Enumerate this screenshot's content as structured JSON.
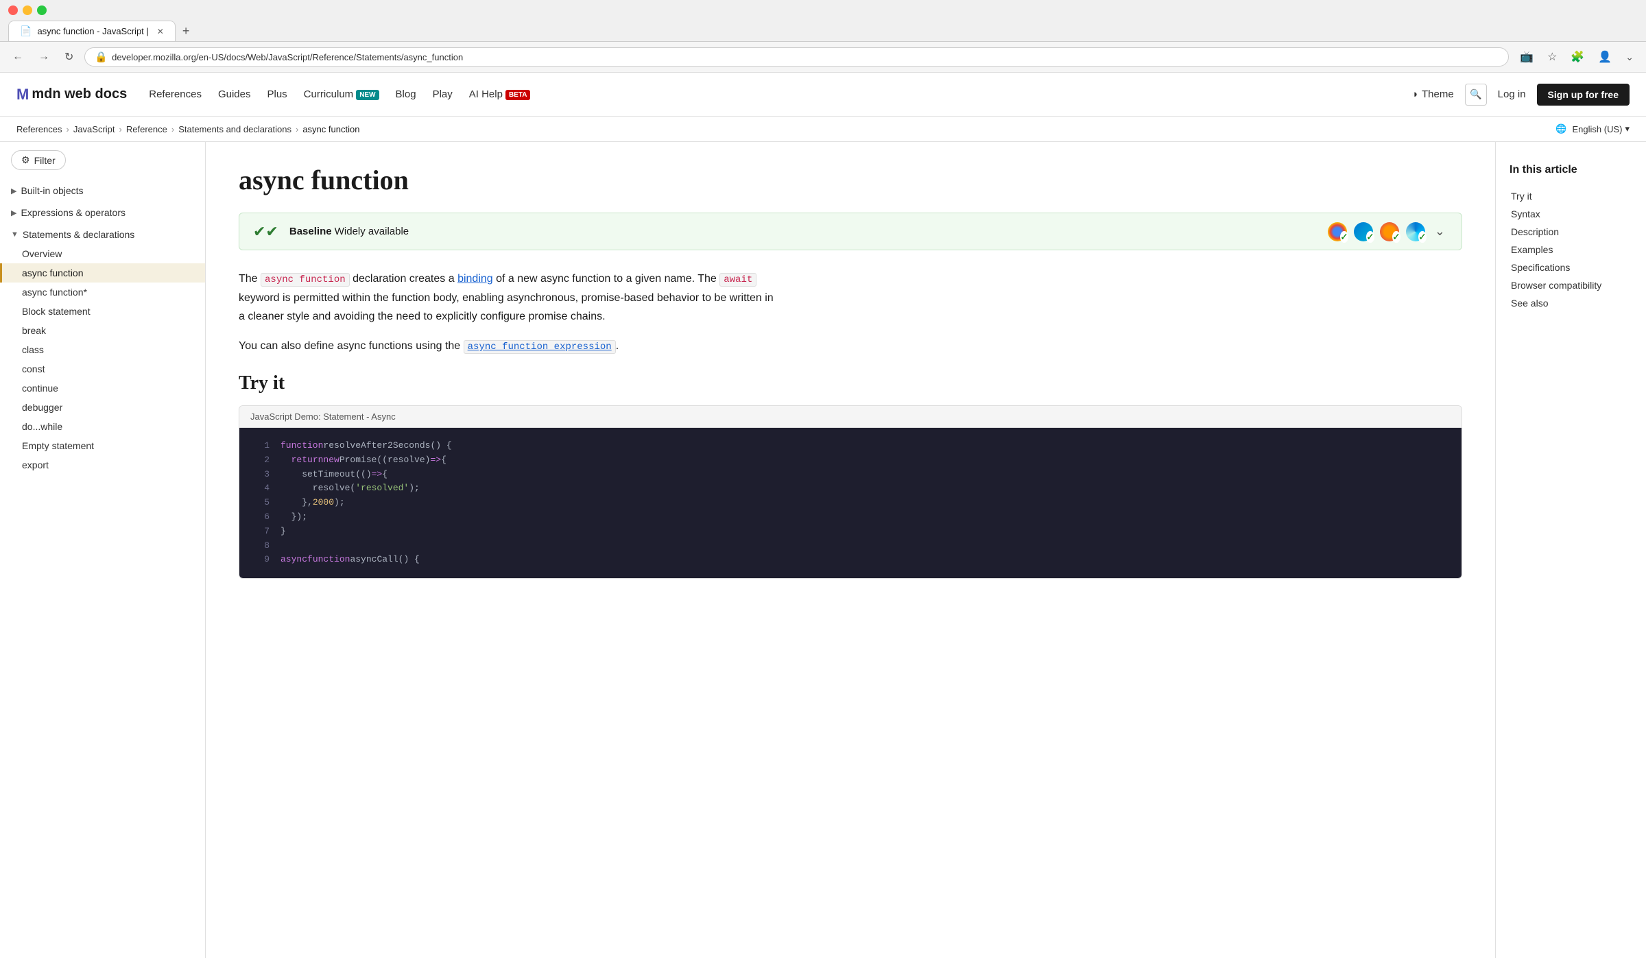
{
  "browser": {
    "tab_title": "async function - JavaScript |",
    "url": "developer.mozilla.org/en-US/docs/Web/JavaScript/Reference/Statements/async_function",
    "new_tab_label": "+"
  },
  "header": {
    "logo_m": "M",
    "logo_text": "mdn web docs",
    "nav_items": [
      {
        "label": "References",
        "badge": null
      },
      {
        "label": "Guides",
        "badge": null
      },
      {
        "label": "Plus",
        "badge": null
      },
      {
        "label": "Curriculum",
        "badge": "NEW"
      },
      {
        "label": "Blog",
        "badge": null
      },
      {
        "label": "Play",
        "badge": null
      },
      {
        "label": "AI Help",
        "badge": "BETA"
      }
    ],
    "theme_label": "Theme",
    "login_label": "Log in",
    "signup_label": "Sign up for free"
  },
  "breadcrumb": {
    "items": [
      {
        "label": "References"
      },
      {
        "label": "JavaScript"
      },
      {
        "label": "Reference"
      },
      {
        "label": "Statements and declarations"
      },
      {
        "label": "async function"
      }
    ],
    "lang": "English (US)"
  },
  "sidebar": {
    "filter_label": "Filter",
    "sections": [
      {
        "label": "Built-in objects",
        "expanded": false,
        "items": []
      },
      {
        "label": "Expressions & operators",
        "expanded": false,
        "items": []
      },
      {
        "label": "Statements & declarations",
        "expanded": true,
        "items": [
          {
            "label": "Overview",
            "active": false
          },
          {
            "label": "async function",
            "active": true
          },
          {
            "label": "async function*",
            "active": false
          },
          {
            "label": "Block statement",
            "active": false
          },
          {
            "label": "break",
            "active": false
          },
          {
            "label": "class",
            "active": false
          },
          {
            "label": "const",
            "active": false
          },
          {
            "label": "continue",
            "active": false
          },
          {
            "label": "debugger",
            "active": false
          },
          {
            "label": "do...while",
            "active": false
          },
          {
            "label": "Empty statement",
            "active": false
          },
          {
            "label": "export",
            "active": false
          }
        ]
      }
    ]
  },
  "main": {
    "page_title": "async function",
    "baseline": {
      "check_icon": "✔",
      "label": "Baseline",
      "description": "Widely available",
      "expand_icon": "⌄"
    },
    "body_p1_before": "The ",
    "body_p1_code": "async function",
    "body_p1_after": " declaration creates a ",
    "body_p1_link": "binding",
    "body_p1_rest": " of a new async function to a given name. The",
    "body_p1_await": "await",
    "body_p1_tail": " keyword is permitted within the function body, enabling asynchronous, promise-based behavior to be written in a cleaner style and avoiding the need to explicitly configure promise chains.",
    "body_p2_before": "You can also define async functions using the ",
    "body_p2_link": "async function expression",
    "body_p2_after": ".",
    "try_it_title": "Try it",
    "code_demo_title": "JavaScript Demo: Statement - Async",
    "code_lines": [
      {
        "num": 1,
        "text": "function resolveAfter2Seconds() {",
        "tokens": [
          {
            "t": "kw",
            "v": "function"
          },
          {
            "t": "default",
            "v": " resolveAfter2Seconds() {"
          }
        ]
      },
      {
        "num": 2,
        "text": "  return new Promise((resolve) => {",
        "tokens": [
          {
            "t": "default",
            "v": "  "
          },
          {
            "t": "kw",
            "v": "return"
          },
          {
            "t": "default",
            "v": " "
          },
          {
            "t": "kw",
            "v": "new"
          },
          {
            "t": "default",
            "v": " Promise((resolve) "
          },
          {
            "t": "arrow",
            "v": "=>"
          },
          {
            "t": "default",
            "v": " {"
          }
        ]
      },
      {
        "num": 3,
        "text": "    setTimeout(() => {",
        "tokens": [
          {
            "t": "default",
            "v": "    setTimeout(() "
          },
          {
            "t": "arrow",
            "v": "=>"
          },
          {
            "t": "default",
            "v": " {"
          }
        ]
      },
      {
        "num": 4,
        "text": "      resolve('resolved');",
        "tokens": [
          {
            "t": "default",
            "v": "      resolve("
          },
          {
            "t": "str",
            "v": "'resolved'"
          },
          {
            "t": "default",
            "v": ");"
          }
        ]
      },
      {
        "num": 5,
        "text": "    }, 2000);",
        "tokens": [
          {
            "t": "default",
            "v": "    }, "
          },
          {
            "t": "num",
            "v": "2000"
          },
          {
            "t": "default",
            "v": ");"
          }
        ]
      },
      {
        "num": 6,
        "text": "  });",
        "tokens": [
          {
            "t": "default",
            "v": "  });"
          }
        ]
      },
      {
        "num": 7,
        "text": "}",
        "tokens": [
          {
            "t": "default",
            "v": "}"
          }
        ]
      },
      {
        "num": 8,
        "text": "",
        "tokens": []
      },
      {
        "num": 9,
        "text": "async function asyncCall() {",
        "tokens": [
          {
            "t": "kw",
            "v": "async"
          },
          {
            "t": "default",
            "v": " "
          },
          {
            "t": "kw",
            "v": "function"
          },
          {
            "t": "default",
            "v": " asyncCall() {"
          }
        ]
      }
    ]
  },
  "toc": {
    "title": "In this article",
    "items": [
      {
        "label": "Try it",
        "active": false
      },
      {
        "label": "Syntax",
        "active": false
      },
      {
        "label": "Description",
        "active": false
      },
      {
        "label": "Examples",
        "active": false
      },
      {
        "label": "Specifications",
        "active": false
      },
      {
        "label": "Browser compatibility",
        "active": false
      },
      {
        "label": "See also",
        "active": false
      }
    ]
  }
}
